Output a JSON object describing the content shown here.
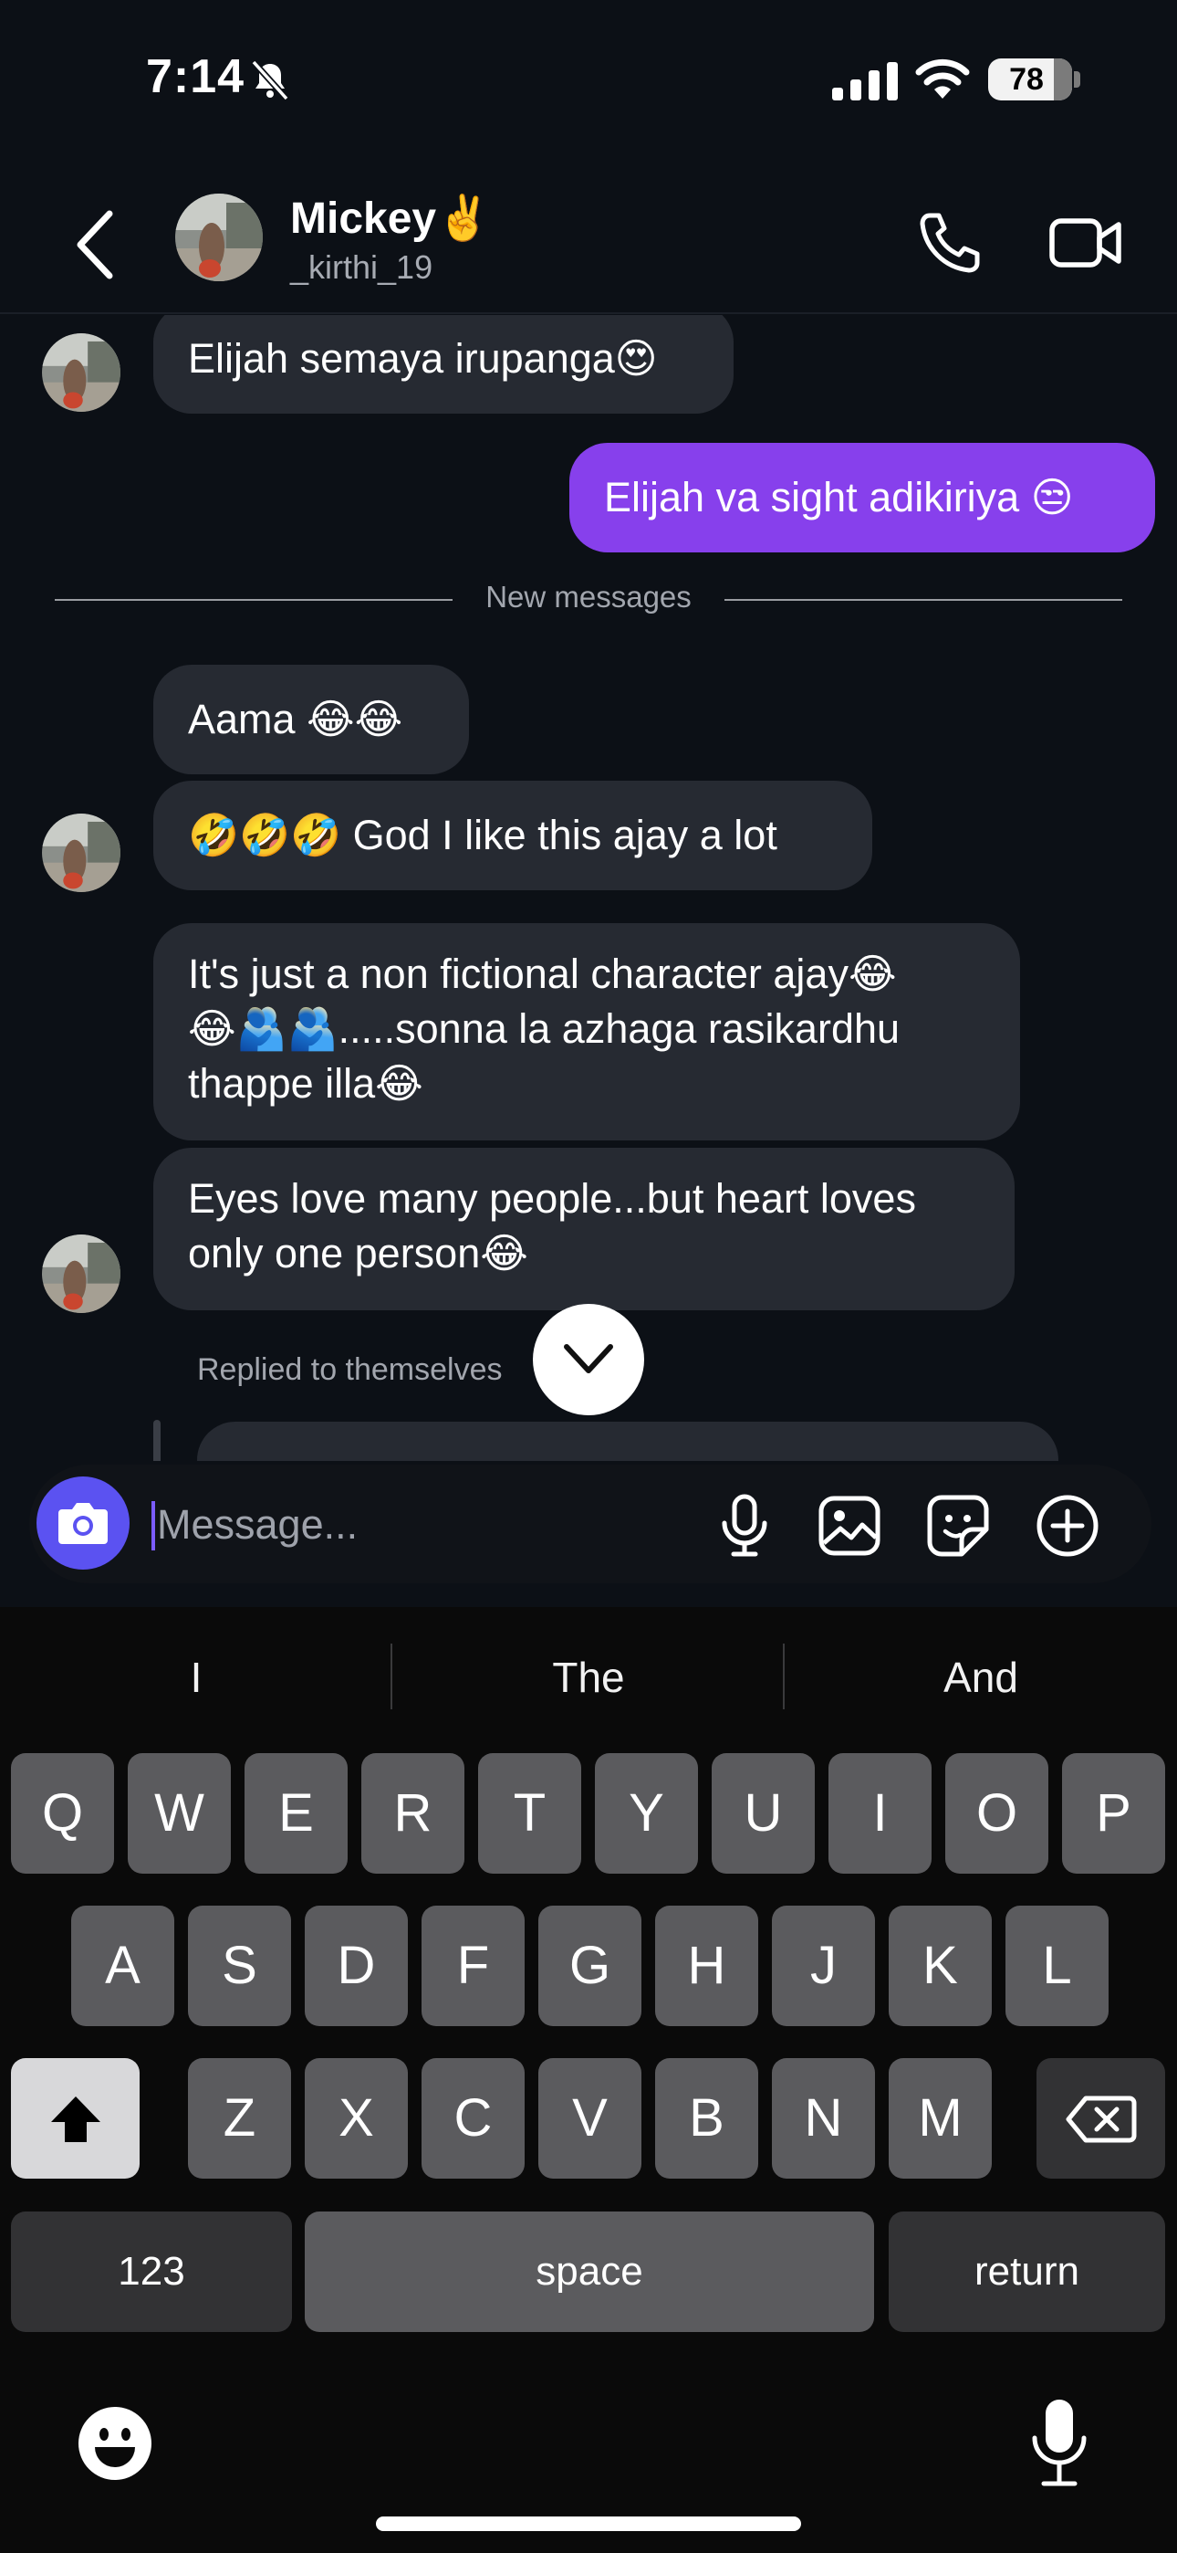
{
  "status_bar": {
    "time": "7:14",
    "battery": "78",
    "battery_level": 0.78
  },
  "header": {
    "name": "Mickey✌️",
    "handle": "_kirthi_19"
  },
  "chat": {
    "messages": [
      {
        "text": "Elijah semaya irupanga😍",
        "direction": "received"
      },
      {
        "text": "Elijah va sight adikiriya 😒",
        "direction": "sent"
      },
      {
        "text": "Aama 😂😂",
        "direction": "received"
      },
      {
        "text": "🤣🤣🤣 God I like this ajay a lot",
        "direction": "received"
      },
      {
        "text": "It's just a non fictional character ajay😂\n😂🫂🫂.....sonna la azhaga rasikardhu\nthappe illa😂",
        "direction": "received"
      },
      {
        "text": "Eyes love many people...but heart loves\nonly one person😂",
        "direction": "received"
      }
    ],
    "divider": "New messages",
    "replied_label": "Replied to themselves"
  },
  "composer": {
    "placeholder": "Message..."
  },
  "keyboard": {
    "suggestions": [
      "I",
      "The",
      "And"
    ],
    "rows": [
      [
        "Q",
        "W",
        "E",
        "R",
        "T",
        "Y",
        "U",
        "I",
        "O",
        "P"
      ],
      [
        "A",
        "S",
        "D",
        "F",
        "G",
        "H",
        "J",
        "K",
        "L"
      ],
      [
        "Z",
        "X",
        "C",
        "V",
        "B",
        "N",
        "M"
      ]
    ],
    "numbers_label": "123",
    "space_label": "space",
    "return_label": "return"
  },
  "colors": {
    "background": "#0c1016",
    "sent_bubble": "#8740ec",
    "received_bubble": "#262a32",
    "camera_button": "#5b52f1"
  }
}
